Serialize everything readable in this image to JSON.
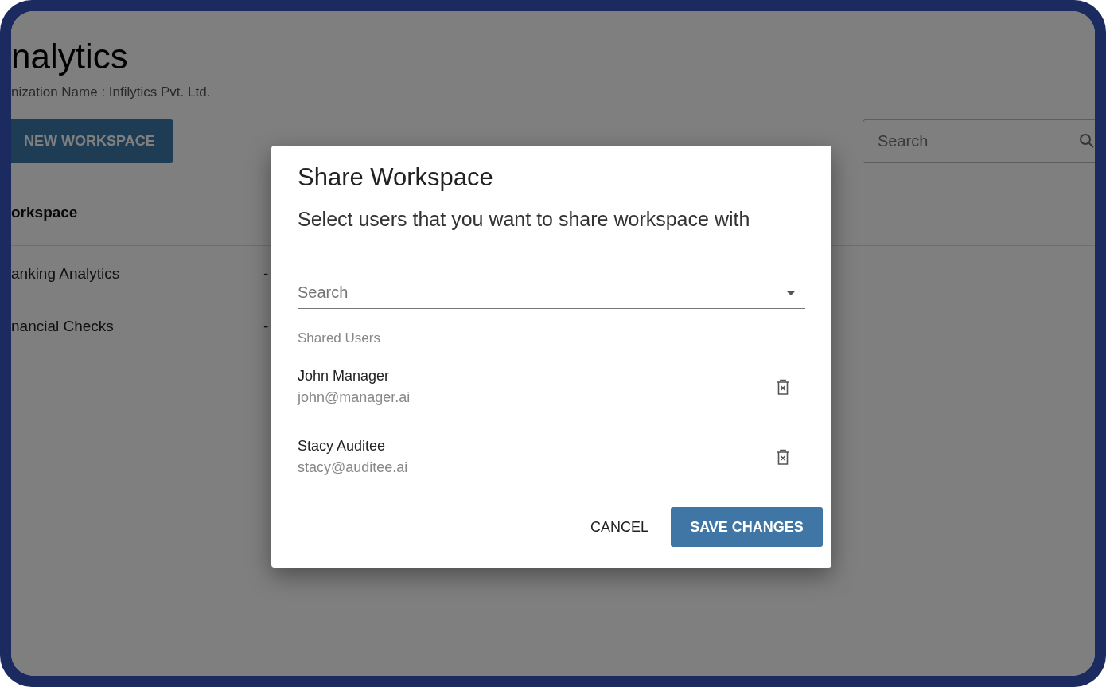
{
  "page": {
    "title": "nalytics",
    "organization": "nization Name : Infilytics Pvt. Ltd.",
    "new_button": "NEW WORKSPACE",
    "search": {
      "placeholder": "Search"
    },
    "table": {
      "columns": [
        "orkspace"
      ],
      "rows": [
        [
          "anking Analytics",
          "-"
        ],
        [
          "nancial Checks",
          "-"
        ]
      ]
    }
  },
  "dialog": {
    "title": "Share Workspace",
    "subtitle": "Select users that you want to share workspace with",
    "search": {
      "placeholder": "Search"
    },
    "section_label": "Shared Users",
    "users": [
      {
        "name": "John Manager",
        "email": "john@manager.ai"
      },
      {
        "name": "Stacy Auditee",
        "email": "stacy@auditee.ai"
      }
    ],
    "buttons": [
      "CANCEL",
      "SAVE CHANGES"
    ]
  }
}
